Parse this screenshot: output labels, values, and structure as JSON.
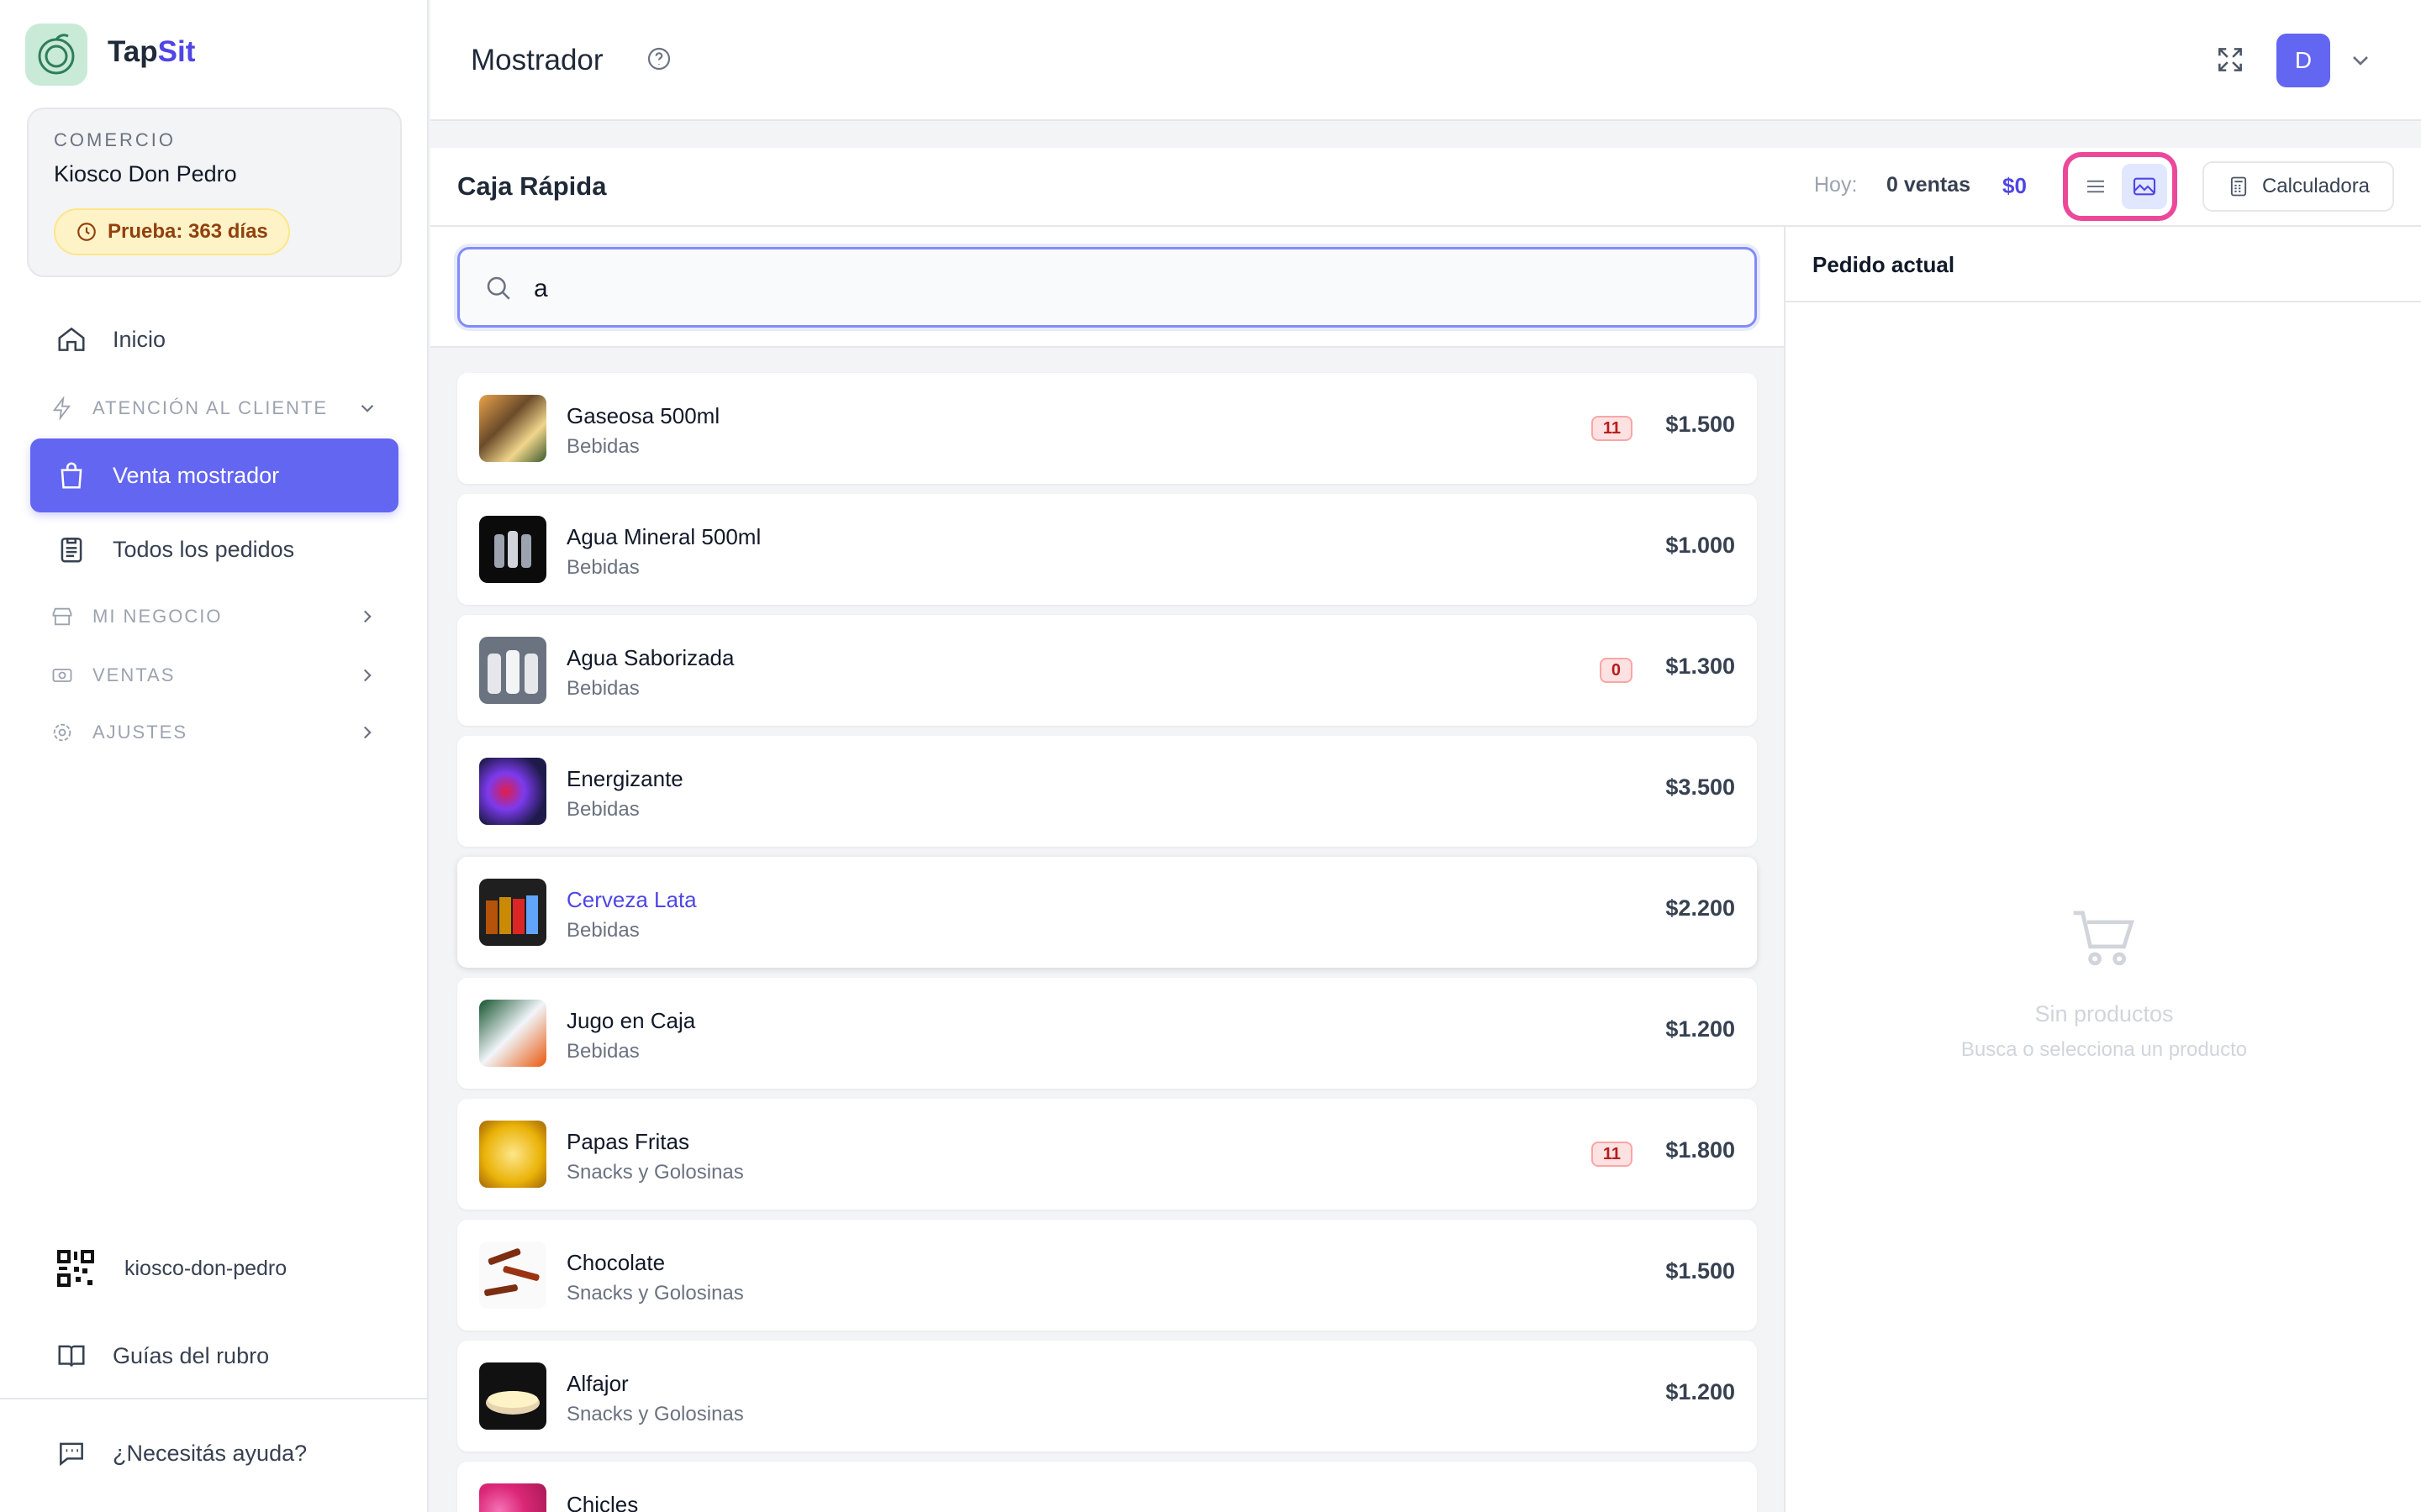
{
  "brand": {
    "part1": "Tap",
    "part2": "Sit"
  },
  "store": {
    "label": "COMERCIO",
    "name": "Kiosco Don Pedro",
    "trial": "Prueba: 363 días"
  },
  "nav": {
    "inicio": "Inicio",
    "atencion": "ATENCIÓN AL CLIENTE",
    "venta": "Venta mostrador",
    "pedidos": "Todos los pedidos",
    "negocio": "MI NEGOCIO",
    "ventas": "VENTAS",
    "ajustes": "AJUSTES",
    "slug": "kiosco-don-pedro",
    "guias": "Guías del rubro",
    "ayuda": "¿Necesitás ayuda?"
  },
  "header": {
    "title": "Mostrador",
    "avatar": "D"
  },
  "panel": {
    "title": "Caja Rápida",
    "today_label": "Hoy:",
    "sales_count": "0 ventas",
    "total": "$0",
    "calc_label": "Calculadora"
  },
  "search": {
    "value": "a"
  },
  "products": [
    {
      "name": "Gaseosa 500ml",
      "category": "Bebidas",
      "price": "$1.500",
      "stock": "11"
    },
    {
      "name": "Agua Mineral 500ml",
      "category": "Bebidas",
      "price": "$1.000",
      "stock": ""
    },
    {
      "name": "Agua Saborizada",
      "category": "Bebidas",
      "price": "$1.300",
      "stock": "0"
    },
    {
      "name": "Energizante",
      "category": "Bebidas",
      "price": "$3.500",
      "stock": ""
    },
    {
      "name": "Cerveza Lata",
      "category": "Bebidas",
      "price": "$2.200",
      "stock": ""
    },
    {
      "name": "Jugo en Caja",
      "category": "Bebidas",
      "price": "$1.200",
      "stock": ""
    },
    {
      "name": "Papas Fritas",
      "category": "Snacks y Golosinas",
      "price": "$1.800",
      "stock": "11"
    },
    {
      "name": "Chocolate",
      "category": "Snacks y Golosinas",
      "price": "$1.500",
      "stock": ""
    },
    {
      "name": "Alfajor",
      "category": "Snacks y Golosinas",
      "price": "$1.200",
      "stock": ""
    },
    {
      "name": "Chicles",
      "category": "",
      "price": "",
      "stock": ""
    }
  ],
  "order": {
    "title": "Pedido actual",
    "empty_title": "Sin productos",
    "empty_sub": "Busca o selecciona un producto"
  },
  "colors": {
    "accent": "#6366f1",
    "highlight": "#ec4899",
    "warning_bg": "#fef3c7"
  }
}
